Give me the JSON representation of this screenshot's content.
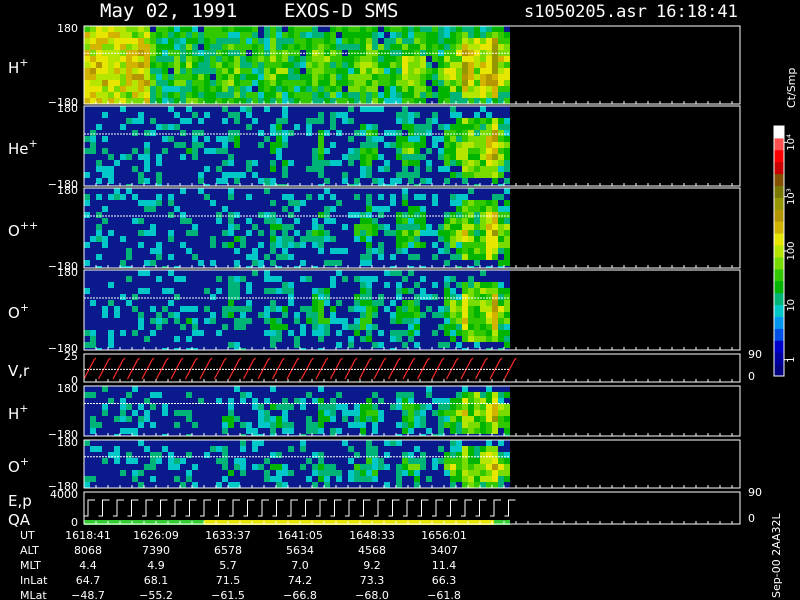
{
  "header": {
    "date": "May 02, 1991",
    "instrument": "EXOS-D SMS",
    "file": "s1050205.asr",
    "time": "16:18:41"
  },
  "colors": {
    "background": "#000000",
    "spectrogram_fill": "#0a1a8c",
    "frame": "#ffffff",
    "velocity_trace": "#ff2a2a",
    "qa_green": "#33cc33",
    "qa_yellow": "#e6e600"
  },
  "colorbar": {
    "unit": "Ct/Smp",
    "ticks": [
      {
        "value": 1,
        "label": "1"
      },
      {
        "value": 10,
        "label": "10"
      },
      {
        "value": 100,
        "label": "100"
      },
      {
        "value": 1000,
        "label": "10³"
      },
      {
        "value": 10000,
        "label": "10⁴"
      }
    ],
    "range": [
      0.5,
      20000
    ],
    "scale": "log",
    "colors": [
      "#000080",
      "#0000a0",
      "#0000c8",
      "#0050e6",
      "#0096f0",
      "#00c8c8",
      "#00b478",
      "#00b400",
      "#32c800",
      "#78dc00",
      "#b4e600",
      "#e6e600",
      "#d2b400",
      "#b49600",
      "#969600",
      "#787800",
      "#825000",
      "#c80000",
      "#ff0000",
      "#ff5050",
      "#ffffff"
    ]
  },
  "chart_data": {
    "type": "heatmap",
    "time_range": [
      "16:18:41",
      "16:56:01"
    ],
    "panels": [
      {
        "id": "h-plus",
        "label": "H",
        "sup": "+",
        "ylim": [
          -180,
          180
        ],
        "ticks": [
          "180",
          "−180"
        ]
      },
      {
        "id": "he-plus",
        "label": "He",
        "sup": "+",
        "ylim": [
          -180,
          180
        ],
        "ticks": [
          "180",
          "−180"
        ]
      },
      {
        "id": "o-plus-plus",
        "label": "O",
        "sup": "++",
        "ylim": [
          -180,
          180
        ],
        "ticks": [
          "180",
          "−180"
        ]
      },
      {
        "id": "o-plus",
        "label": "O",
        "sup": "+",
        "ylim": [
          -180,
          180
        ],
        "ticks": [
          "180",
          "−180"
        ]
      },
      {
        "id": "vr",
        "label": "V,r",
        "sup": "",
        "ylim": [
          0,
          25
        ],
        "ticks": [
          "25",
          "0"
        ],
        "right_ticks": [
          "90",
          "0"
        ]
      },
      {
        "id": "h-plus-2",
        "label": "H",
        "sup": "+",
        "ylim": [
          -180,
          180
        ],
        "ticks": [
          "180",
          "−180"
        ]
      },
      {
        "id": "o-plus-2",
        "label": "O",
        "sup": "+",
        "ylim": [
          -180,
          180
        ],
        "ticks": [
          "180",
          "−180"
        ]
      },
      {
        "id": "ep-qa",
        "label": "E,p",
        "label2": "QA",
        "sup": "",
        "ylim": [
          0,
          4000
        ],
        "ticks": [
          "4000",
          "0"
        ],
        "right_ticks": [
          "90",
          "0"
        ]
      }
    ],
    "ephemeris": {
      "rows": [
        "UT",
        "ALT",
        "MLT",
        "InLat",
        "MLat"
      ],
      "values": [
        [
          "1618:41",
          "1626:09",
          "1633:37",
          "1641:05",
          "1648:33",
          "1656:01"
        ],
        [
          "8068",
          "7390",
          "6578",
          "5634",
          "4568",
          "3407"
        ],
        [
          "4.4",
          "4.9",
          "5.7",
          "7.0",
          "9.2",
          "11.4"
        ],
        [
          "64.7",
          "68.1",
          "71.5",
          "74.2",
          "73.3",
          "66.3"
        ],
        [
          "−48.7",
          "−55.2",
          "−61.5",
          "−66.8",
          "−68.0",
          "−61.8"
        ]
      ]
    }
  },
  "footer": {
    "stamp": "Sep-00 2AA32L"
  }
}
